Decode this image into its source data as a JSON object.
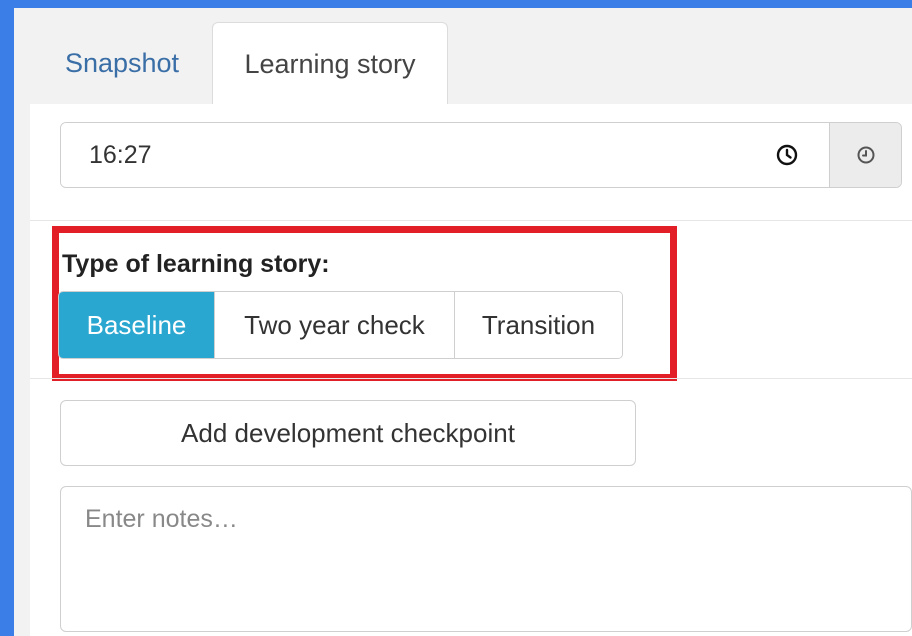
{
  "tabs": [
    {
      "label": "Snapshot",
      "active": false
    },
    {
      "label": "Learning story",
      "active": true
    }
  ],
  "time": {
    "value": "16:27",
    "clock_icon": "clock-icon",
    "addon_icon": "clock-icon"
  },
  "story_type": {
    "label": "Type of learning story:",
    "options": [
      "Baseline",
      "Two year check",
      "Transition"
    ],
    "selected": "Baseline"
  },
  "add_checkpoint": {
    "label": "Add development checkpoint"
  },
  "notes": {
    "placeholder": "Enter notes…"
  },
  "colors": {
    "accent": "#29a7d0",
    "highlight": "#e21f26",
    "page_bg": "#3b7ee8",
    "link": "#3a6ea6"
  }
}
